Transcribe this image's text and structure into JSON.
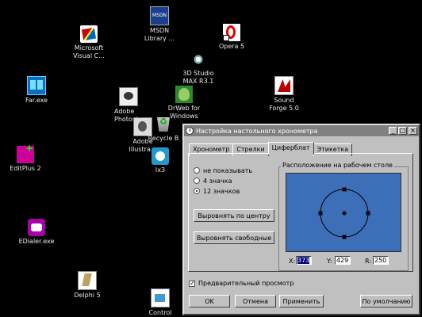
{
  "desktop": {
    "icons": [
      {
        "label": "MSDN\nLibrary ..."
      },
      {
        "label": "Microsoft\nVisual C..."
      },
      {
        "label": "Opera 5"
      },
      {
        "label": "3D Studio\nMAX R3.1"
      },
      {
        "label": "Far.exe"
      },
      {
        "label": "Adobe\nPhotosh"
      },
      {
        "label": "DrWeb for\nWindows"
      },
      {
        "label": "Sound\nForge 5.0"
      },
      {
        "label": "Adobe\nIllustra..."
      },
      {
        "label": "Recycle B"
      },
      {
        "label": "Ix3"
      },
      {
        "label": "EditPlus 2"
      },
      {
        "label": "EDialer.exe"
      },
      {
        "label": "Delphi 5"
      },
      {
        "label": "Control"
      }
    ]
  },
  "window": {
    "title": "Настройка настольного хронометра",
    "controls": {
      "minimize": "_",
      "maximize": "□",
      "close": "×"
    },
    "tabs": [
      {
        "label": "Хронометр",
        "active": false
      },
      {
        "label": "Стрелки",
        "active": false
      },
      {
        "label": "Циферблат",
        "active": true
      },
      {
        "label": "Этикетка",
        "active": false
      }
    ],
    "radio_options": [
      {
        "label": "не показывать",
        "selected": false
      },
      {
        "label": "4 значка",
        "selected": false
      },
      {
        "label": "12 значков",
        "selected": true
      }
    ],
    "buttons": {
      "align_center": "Выровнять по центру",
      "align_free": "Выровнять свободные",
      "ok": "OK",
      "cancel": "Отмена",
      "apply": "Применить",
      "defaults": "По умолчанию"
    },
    "position_group": {
      "label": "Расположение на рабочем столе",
      "screen_color": "#3d6eb8",
      "x_label": "X:",
      "x_value": "373",
      "y_label": "Y:",
      "y_value": "429",
      "r_label": "R:",
      "r_value": "250"
    },
    "preview": {
      "label": "Предварительный просмотр",
      "checked": true,
      "mark": "✓"
    }
  }
}
